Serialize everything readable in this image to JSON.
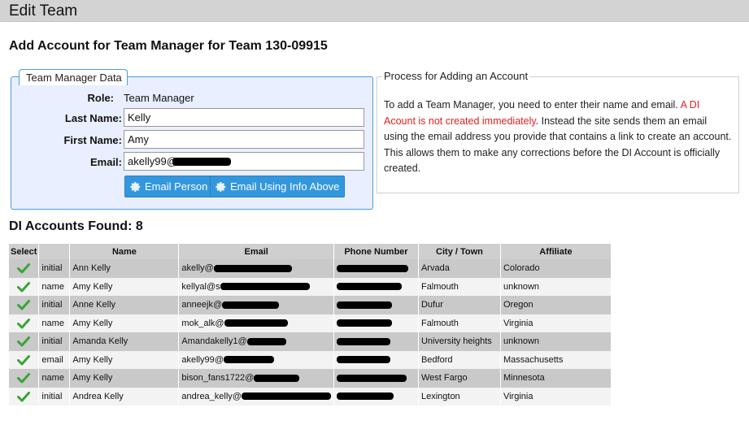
{
  "header": {
    "title": "Edit Team"
  },
  "heading": "Add Account for Team Manager for Team 130-09915",
  "team_manager": {
    "legend": "Team Manager Data",
    "role_label": "Role:",
    "role_value": "Team Manager",
    "last_name_label": "Last Name:",
    "last_name_value": "Kelly",
    "first_name_label": "First Name:",
    "first_name_value": "Amy",
    "email_label": "Email:",
    "email_value": "akelly99@",
    "email_person_button": "Email Person",
    "email_info_button": "Email Using Info Above"
  },
  "process": {
    "legend": "Process for Adding an Account",
    "text_before": "To add a Team Manager, you need to enter their name and email. ",
    "text_warning": "A DI Acount is not created immediately",
    "text_after": ". Instead the site sends them an email using the email address you provide that contains a link to create an account. This allows them to make any corrections before the DI Account is officially created."
  },
  "accounts": {
    "found_label": "DI Accounts Found: 8",
    "columns": [
      "Select",
      "",
      "Name",
      "Email",
      "Phone Number",
      "City / Town",
      "Affiliate"
    ],
    "rows": [
      {
        "match": "initial",
        "name": "Ann Kelly",
        "email": "akelly@",
        "city": "Arvada",
        "affiliate": "Colorado"
      },
      {
        "match": "name",
        "name": "Amy Kelly",
        "email": "kellyal@s",
        "city": "Falmouth",
        "affiliate": "unknown"
      },
      {
        "match": "initial",
        "name": "Anne Kelly",
        "email": "anneejk@",
        "city": "Dufur",
        "affiliate": "Oregon"
      },
      {
        "match": "name",
        "name": "Amy Kelly",
        "email": "mok_alk@",
        "city": "Falmouth",
        "affiliate": "Virginia"
      },
      {
        "match": "initial",
        "name": "Amanda Kelly",
        "email": "Amandakelly1@",
        "city": "University heights",
        "affiliate": "unknown"
      },
      {
        "match": "email",
        "name": "Amy Kelly",
        "email": "akelly99@",
        "city": "Bedford",
        "affiliate": "Massachusetts"
      },
      {
        "match": "name",
        "name": "Amy Kelly",
        "email": "bison_fans1722@",
        "city": "West Fargo",
        "affiliate": "Minnesota"
      },
      {
        "match": "initial",
        "name": "Andrea Kelly",
        "email": "andrea_kelly@",
        "city": "Lexington",
        "affiliate": "Virginia"
      }
    ]
  },
  "colors": {
    "accent": "#3397de",
    "warning": "#e02020",
    "check": "#3aa33a"
  },
  "icons": {
    "button": "gear-icon",
    "select": "checkmark-icon"
  }
}
